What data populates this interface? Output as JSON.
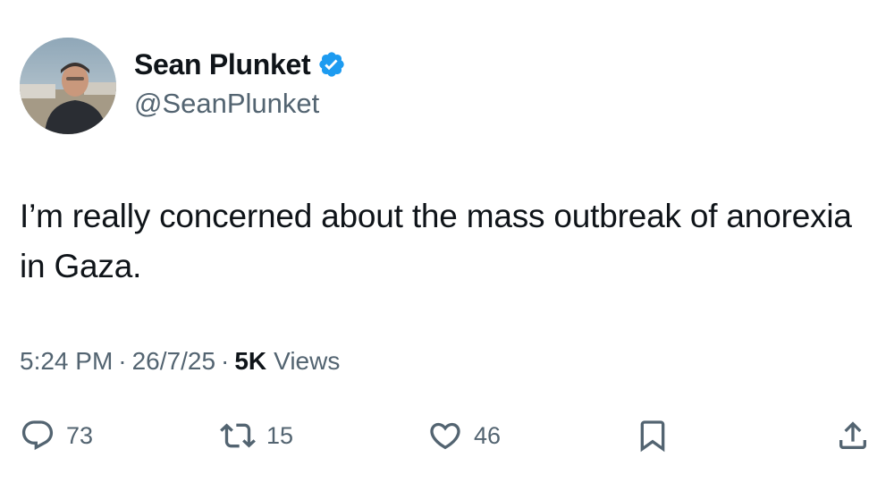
{
  "author": {
    "display_name": "Sean Plunket",
    "handle": "@SeanPlunket",
    "verified": true
  },
  "tweet": {
    "text": "I’m really concerned about the mass outbreak of anorexia in Gaza.",
    "time": "5:24 PM",
    "date": "26/7/25",
    "views_count": "5K",
    "views_label": "Views"
  },
  "actions": {
    "replies": "73",
    "retweets": "15",
    "likes": "46"
  },
  "colors": {
    "text": "#0f1419",
    "secondary": "#536471",
    "verified": "#1d9bf0"
  },
  "icons": [
    "reply-icon",
    "retweet-icon",
    "like-icon",
    "bookmark-icon",
    "share-icon",
    "verified-badge-icon"
  ]
}
